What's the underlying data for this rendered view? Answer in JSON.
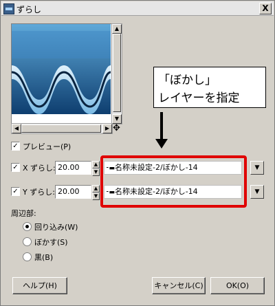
{
  "window": {
    "title": "ずらし",
    "close": "X"
  },
  "callout": {
    "line1": "「ぼかし」",
    "line2": "レイヤーを指定"
  },
  "preview": {
    "label": "プレビュー(P)",
    "checked": true
  },
  "x_shift": {
    "label": "X ずらし:",
    "value": "20.00",
    "layer": "名称未設定-2/ぼかし-14",
    "checked": true
  },
  "y_shift": {
    "label": "Y ずらし:",
    "value": "20.00",
    "layer": "名称未設定-2/ぼかし-14",
    "checked": true
  },
  "edge": {
    "heading": "周辺部:",
    "options": [
      {
        "label": "回り込み(W)",
        "selected": true
      },
      {
        "label": "ぼかす(S)",
        "selected": false
      },
      {
        "label": "黒(B)",
        "selected": false
      }
    ]
  },
  "buttons": {
    "help": "ヘルプ(H)",
    "cancel": "キャンセル(C)",
    "ok": "OK(O)"
  },
  "icons": {
    "app": "displace-app-icon",
    "move": "move-cross-icon",
    "dropdown": "triangle-down-icon"
  }
}
